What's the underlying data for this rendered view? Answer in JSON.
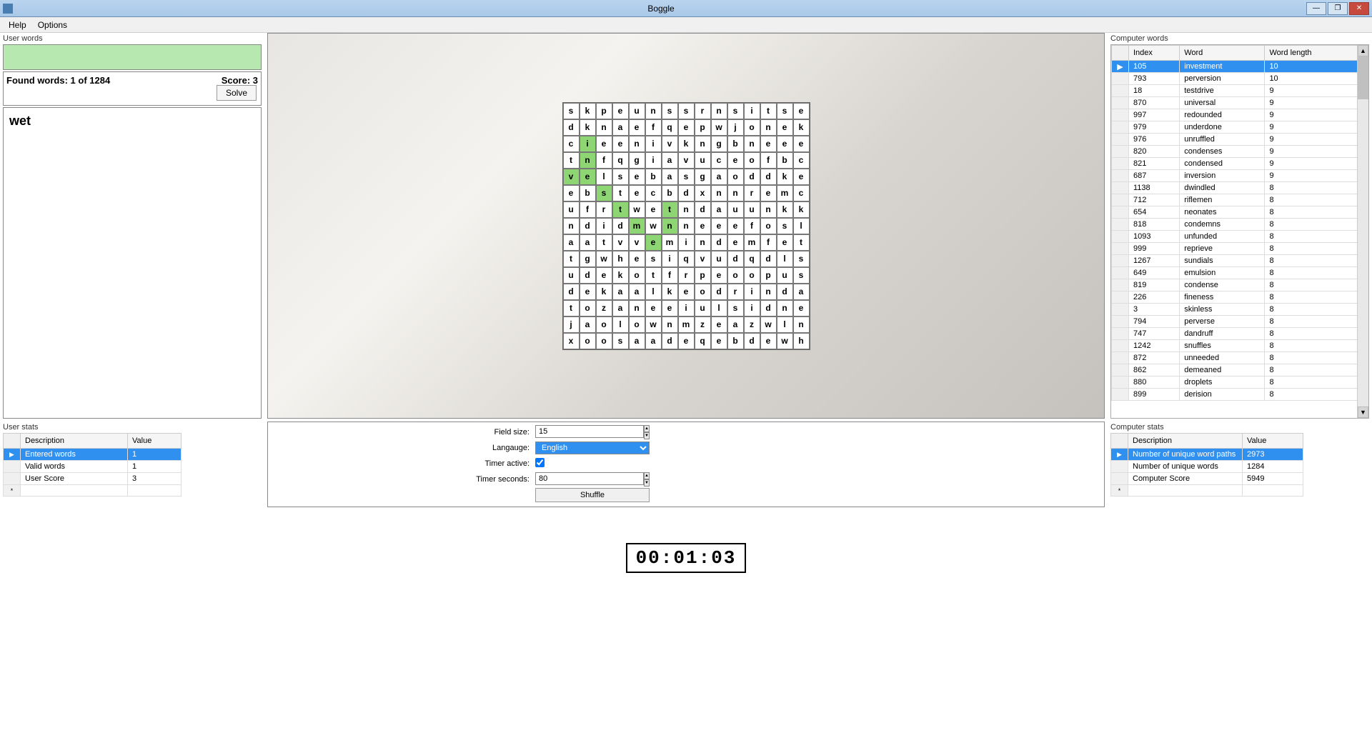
{
  "window": {
    "title": "Boggle"
  },
  "menu": {
    "help": "Help",
    "options": "Options"
  },
  "left": {
    "panel_label": "User words",
    "found_words": "Found words: 1 of 1284",
    "score": "Score: 3",
    "solve": "Solve",
    "word": "wet"
  },
  "board": {
    "rows": [
      [
        "s",
        "k",
        "p",
        "e",
        "u",
        "n",
        "s",
        "s",
        "r",
        "n",
        "s",
        "i",
        "t",
        "s",
        "e"
      ],
      [
        "d",
        "k",
        "n",
        "a",
        "e",
        "f",
        "q",
        "e",
        "p",
        "w",
        "j",
        "o",
        "n",
        "e",
        "k"
      ],
      [
        "c",
        "i",
        "e",
        "e",
        "n",
        "i",
        "v",
        "k",
        "n",
        "g",
        "b",
        "n",
        "e",
        "e",
        "e"
      ],
      [
        "t",
        "n",
        "f",
        "q",
        "g",
        "i",
        "a",
        "v",
        "u",
        "c",
        "e",
        "o",
        "f",
        "b",
        "c"
      ],
      [
        "v",
        "e",
        "l",
        "s",
        "e",
        "b",
        "a",
        "s",
        "g",
        "a",
        "o",
        "d",
        "d",
        "k",
        "e"
      ],
      [
        "e",
        "b",
        "s",
        "t",
        "e",
        "c",
        "b",
        "d",
        "x",
        "n",
        "n",
        "r",
        "e",
        "m",
        "c"
      ],
      [
        "u",
        "f",
        "r",
        "t",
        "w",
        "e",
        "t",
        "n",
        "d",
        "a",
        "u",
        "u",
        "n",
        "k",
        "k"
      ],
      [
        "n",
        "d",
        "i",
        "d",
        "m",
        "w",
        "n",
        "n",
        "e",
        "e",
        "e",
        "f",
        "o",
        "s",
        "l"
      ],
      [
        "a",
        "a",
        "t",
        "v",
        "v",
        "e",
        "m",
        "i",
        "n",
        "d",
        "e",
        "m",
        "f",
        "e",
        "t"
      ],
      [
        "t",
        "g",
        "w",
        "h",
        "e",
        "s",
        "i",
        "q",
        "v",
        "u",
        "d",
        "q",
        "d",
        "l",
        "s"
      ],
      [
        "u",
        "d",
        "e",
        "k",
        "o",
        "t",
        "f",
        "r",
        "p",
        "e",
        "o",
        "o",
        "p",
        "u",
        "s"
      ],
      [
        "d",
        "e",
        "k",
        "a",
        "a",
        "l",
        "k",
        "e",
        "o",
        "d",
        "r",
        "i",
        "n",
        "d",
        "a"
      ],
      [
        "t",
        "o",
        "z",
        "a",
        "n",
        "e",
        "e",
        "i",
        "u",
        "l",
        "s",
        "i",
        "d",
        "n",
        "e"
      ],
      [
        "j",
        "a",
        "o",
        "l",
        "o",
        "w",
        "n",
        "m",
        "z",
        "e",
        "a",
        "z",
        "w",
        "l",
        "n"
      ],
      [
        "x",
        "o",
        "o",
        "s",
        "a",
        "a",
        "d",
        "e",
        "q",
        "e",
        "b",
        "d",
        "e",
        "w",
        "h"
      ]
    ],
    "highlights": [
      [
        2,
        1
      ],
      [
        3,
        1
      ],
      [
        4,
        0
      ],
      [
        4,
        1
      ],
      [
        5,
        2
      ],
      [
        6,
        3
      ],
      [
        6,
        6
      ],
      [
        7,
        4
      ],
      [
        7,
        6
      ],
      [
        8,
        5
      ]
    ]
  },
  "right": {
    "panel_label": "Computer words",
    "headers": {
      "index": "Index",
      "word": "Word",
      "length": "Word length"
    },
    "rows": [
      {
        "i": "105",
        "w": "investment",
        "l": "10"
      },
      {
        "i": "793",
        "w": "perversion",
        "l": "10"
      },
      {
        "i": "18",
        "w": "testdrive",
        "l": "9"
      },
      {
        "i": "870",
        "w": "universal",
        "l": "9"
      },
      {
        "i": "997",
        "w": "redounded",
        "l": "9"
      },
      {
        "i": "979",
        "w": "underdone",
        "l": "9"
      },
      {
        "i": "976",
        "w": "unruffled",
        "l": "9"
      },
      {
        "i": "820",
        "w": "condenses",
        "l": "9"
      },
      {
        "i": "821",
        "w": "condensed",
        "l": "9"
      },
      {
        "i": "687",
        "w": "inversion",
        "l": "9"
      },
      {
        "i": "1138",
        "w": "dwindled",
        "l": "8"
      },
      {
        "i": "712",
        "w": "riflemen",
        "l": "8"
      },
      {
        "i": "654",
        "w": "neonates",
        "l": "8"
      },
      {
        "i": "818",
        "w": "condemns",
        "l": "8"
      },
      {
        "i": "1093",
        "w": "unfunded",
        "l": "8"
      },
      {
        "i": "999",
        "w": "reprieve",
        "l": "8"
      },
      {
        "i": "1267",
        "w": "sundials",
        "l": "8"
      },
      {
        "i": "649",
        "w": "emulsion",
        "l": "8"
      },
      {
        "i": "819",
        "w": "condense",
        "l": "8"
      },
      {
        "i": "226",
        "w": "fineness",
        "l": "8"
      },
      {
        "i": "3",
        "w": "skinless",
        "l": "8"
      },
      {
        "i": "794",
        "w": "perverse",
        "l": "8"
      },
      {
        "i": "747",
        "w": "dandruff",
        "l": "8"
      },
      {
        "i": "1242",
        "w": "snuffles",
        "l": "8"
      },
      {
        "i": "872",
        "w": "unneeded",
        "l": "8"
      },
      {
        "i": "862",
        "w": "demeaned",
        "l": "8"
      },
      {
        "i": "880",
        "w": "droplets",
        "l": "8"
      },
      {
        "i": "899",
        "w": "derision",
        "l": "8"
      }
    ]
  },
  "user_stats": {
    "panel_label": "User stats",
    "headers": {
      "desc": "Description",
      "val": "Value"
    },
    "rows": [
      {
        "d": "Entered words",
        "v": "1"
      },
      {
        "d": "Valid words",
        "v": "1"
      },
      {
        "d": "User Score",
        "v": "3"
      }
    ]
  },
  "settings": {
    "field_size_lbl": "Field size:",
    "field_size": "15",
    "language_lbl": "Langauge:",
    "language": "English",
    "timer_active_lbl": "Timer active:",
    "timer_active": true,
    "timer_seconds_lbl": "Timer seconds:",
    "timer_seconds": "80",
    "shuffle": "Shuffle",
    "timer_display": "00:01:03"
  },
  "comp_stats": {
    "panel_label": "Computer stats",
    "headers": {
      "desc": "Description",
      "val": "Value"
    },
    "rows": [
      {
        "d": "Number of unique word paths",
        "v": "2973"
      },
      {
        "d": "Number of unique words",
        "v": "1284"
      },
      {
        "d": "Computer Score",
        "v": "5949"
      }
    ]
  }
}
